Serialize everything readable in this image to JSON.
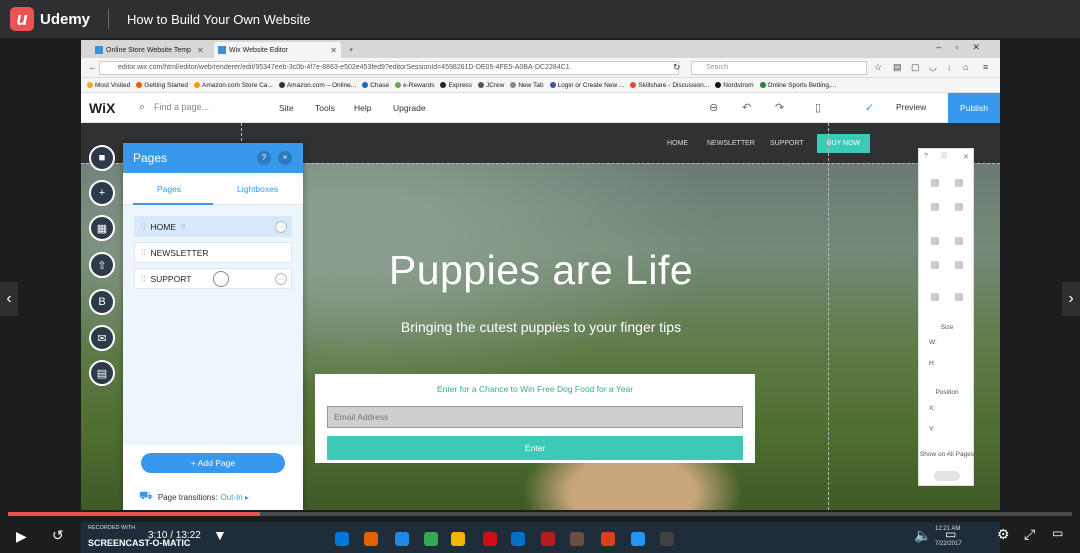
{
  "udemy": {
    "brand": "Udemy",
    "course_title": "How to Build Your Own Website"
  },
  "browser": {
    "tabs": [
      {
        "label": "Online Store Website Temp"
      },
      {
        "label": "Wix Website Editor"
      }
    ],
    "url": "editor.wix.com/html/editor/web/renderer/edit/95347eeb-3c0b-4f7e-8863-e502e453fed9?editorSessionId=4598261D-DE05-4FE5-A0BA-DC2284C1",
    "search_placeholder": "Search",
    "bookmarks": [
      "Most Visited",
      "Getting Started",
      "Amazon.com Store Ca...",
      "Amazon.com – Online...",
      "Chase",
      "e-Rewards",
      "Express",
      "JCrew",
      "New Tab",
      "Login or Create New ...",
      "Skillshare - Discussion...",
      "Nordstrom",
      "Online Sports Betting,..."
    ]
  },
  "wix": {
    "logo": "WiX",
    "find_page": "Find a page...",
    "menu": [
      "Site",
      "Tools",
      "Help",
      "Upgrade"
    ],
    "preview": "Preview",
    "publish": "Publish"
  },
  "site": {
    "nav": [
      "HOME",
      "NEWSLETTER",
      "SUPPORT"
    ],
    "buy_now": "BUY NOW",
    "hero_title": "Puppies are Life",
    "hero_subtitle": "Bringing the cutest puppies to your finger tips",
    "signup_text": "Enter for a Chance to Win Free Dog Food for a Year",
    "email_placeholder": "Email Address",
    "enter_label": "Enter"
  },
  "pages_panel": {
    "title": "Pages",
    "help": "?",
    "close": "×",
    "tabs": [
      "Pages",
      "Lightboxes"
    ],
    "pages": [
      "HOME",
      "NEWSLETTER",
      "SUPPORT"
    ],
    "add_page": "+ Add Page",
    "transitions_label": "Page transitions:",
    "transitions_value": "Out-In ▸"
  },
  "props_panel": {
    "size": "Size",
    "w": "W:",
    "h": "H:",
    "position": "Position",
    "x": "X:",
    "y": "Y:",
    "show_all": "Show on All Pages"
  },
  "player": {
    "time": "3:10 / 13:22",
    "progress": 0.237,
    "watermark_line1": "RECORDED WITH",
    "watermark_line2": "SCREENCAST-O-MATIC",
    "clock_time": "12:21 AM",
    "clock_date": "7/22/2017"
  },
  "colors": {
    "udemy_red": "#ec5252",
    "wix_blue": "#3899ec",
    "teal": "#3cc9b6"
  }
}
